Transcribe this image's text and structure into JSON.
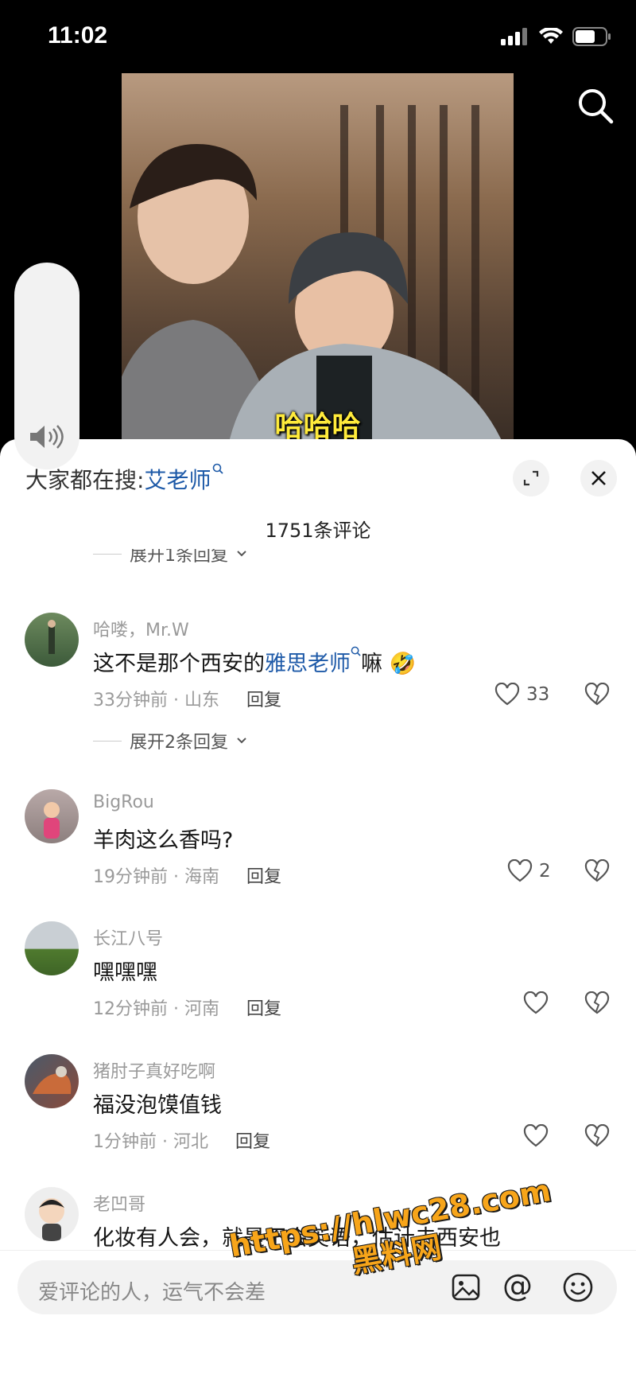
{
  "status_bar": {
    "time": "11:02"
  },
  "video": {
    "caption": "哈哈哈"
  },
  "sheet": {
    "hot_search_prefix": "大家都在搜:",
    "hot_search_term": "艾老师",
    "comment_count": "1751条评论",
    "partial_expand": "展开1条回复"
  },
  "comments": [
    {
      "user": "哈喽，Mr.W",
      "text_pre": "这不是那个西安的",
      "text_link": "雅思老师",
      "text_post": "嘛 🤣",
      "time_location": "33分钟前 · 山东",
      "reply": "回复",
      "likes": "33",
      "expand": "展开2条回复"
    },
    {
      "user": "BigRou",
      "text": "羊肉这么香吗?",
      "time_location": "19分钟前 · 海南",
      "reply": "回复",
      "likes": "2"
    },
    {
      "user": "长江八号",
      "text": "嘿嘿嘿",
      "time_location": "12分钟前 · 河南",
      "reply": "回复",
      "likes": ""
    },
    {
      "user": "猪肘子真好吃啊",
      "text": "福没泡馍值钱",
      "time_location": "1分钟前 · 河北",
      "reply": "回复",
      "likes": ""
    },
    {
      "user": "老凹哥",
      "text": "化妆有人会，就是不会英语，估计去西安也"
    }
  ],
  "input": {
    "placeholder": "爱评论的人，运气不会差"
  },
  "watermark": {
    "line1": "https://hlwc28.com",
    "line2": "黑料网"
  },
  "icons": [
    "signal-icon",
    "wifi-icon",
    "battery-icon",
    "search-icon",
    "volume-icon",
    "expand-icon",
    "close-icon",
    "heart-icon",
    "broken-heart-icon",
    "image-icon",
    "at-icon",
    "emoji-icon"
  ]
}
